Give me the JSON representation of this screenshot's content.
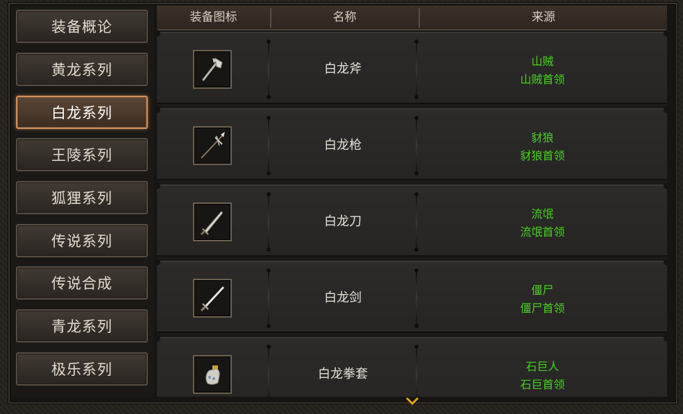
{
  "sidebar": {
    "items": [
      {
        "label": "装备概论",
        "active": false
      },
      {
        "label": "黄龙系列",
        "active": false
      },
      {
        "label": "白龙系列",
        "active": true
      },
      {
        "label": "王陵系列",
        "active": false
      },
      {
        "label": "狐狸系列",
        "active": false
      },
      {
        "label": "传说系列",
        "active": false
      },
      {
        "label": "传说合成",
        "active": false
      },
      {
        "label": "青龙系列",
        "active": false
      },
      {
        "label": "极乐系列",
        "active": false
      }
    ]
  },
  "table": {
    "headers": {
      "icon": "装备图标",
      "name": "名称",
      "source": "来源"
    },
    "rows": [
      {
        "icon": "axe-icon",
        "name": "白龙斧",
        "source": [
          "山贼",
          "山贼首领"
        ]
      },
      {
        "icon": "spear-icon",
        "name": "白龙枪",
        "source": [
          "豺狼",
          "豺狼首领"
        ]
      },
      {
        "icon": "blade-icon",
        "name": "白龙刀",
        "source": [
          "流氓",
          "流氓首领"
        ]
      },
      {
        "icon": "sword-icon",
        "name": "白龙剑",
        "source": [
          "僵尸",
          "僵尸首领"
        ]
      },
      {
        "icon": "gauntlet-icon",
        "name": "白龙拳套",
        "source": [
          "石巨人",
          "石巨首领"
        ]
      }
    ]
  },
  "colors": {
    "source_text": "#49d021",
    "active_border": "#d08f5d"
  }
}
